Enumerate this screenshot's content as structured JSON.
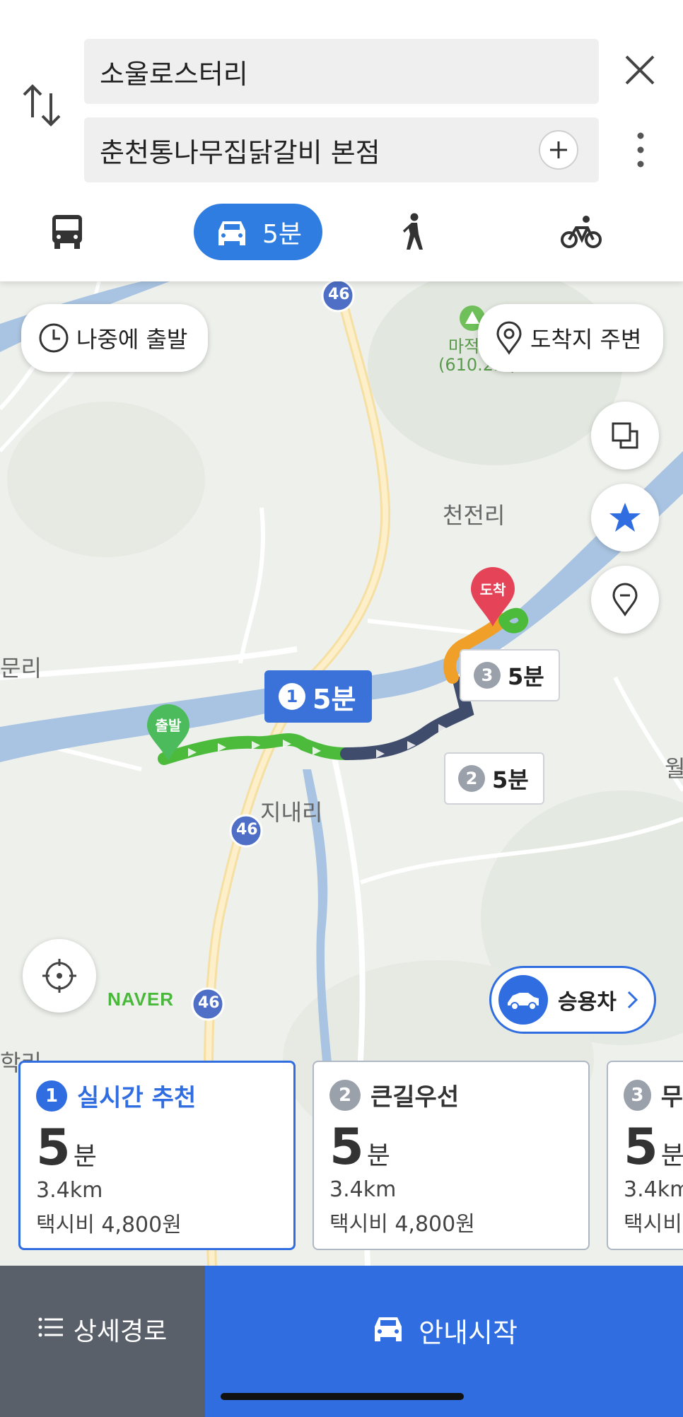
{
  "search": {
    "origin": "소울로스터리",
    "destination": "춘천통나무집닭갈비 본점"
  },
  "modes": {
    "car_time": "5분"
  },
  "map": {
    "later_departure_label": "나중에 출발",
    "nearby_destination_label": "도착지 주변",
    "place_labels": {
      "mountain": "마적",
      "mountain_height": "(610.2m)",
      "village_1": "천전리",
      "village_2": "지내리",
      "village_3": "문리",
      "village_4": "학리",
      "village_5": "월"
    },
    "road_shields": [
      "46",
      "46",
      "46"
    ],
    "start_marker": "출발",
    "end_marker": "도착",
    "callouts": [
      {
        "num": "1",
        "time": "5분"
      },
      {
        "num": "2",
        "time": "5분"
      },
      {
        "num": "3",
        "time": "5분"
      }
    ],
    "logo": "NAVER",
    "vehicle_label": "승용차",
    "route_colors": {
      "green": "#4cbb3c",
      "navy": "#3f4c6b",
      "orange": "#f0a028"
    }
  },
  "routes": [
    {
      "num": "1",
      "name": "실시간 추천",
      "time": "5",
      "unit": "분",
      "distance": "3.4km",
      "fare": "택시비 4,800원"
    },
    {
      "num": "2",
      "name": "큰길우선",
      "time": "5",
      "unit": "분",
      "distance": "3.4km",
      "fare": "택시비 4,800원"
    },
    {
      "num": "3",
      "name": "무",
      "time": "5",
      "unit": "분",
      "distance": "3.4km",
      "fare": "택시비"
    }
  ],
  "bottom": {
    "detail_label": "상세경로",
    "start_label": "안내시작"
  },
  "colors": {
    "accent": "#2f6de1",
    "dark_button": "#5a6069"
  }
}
